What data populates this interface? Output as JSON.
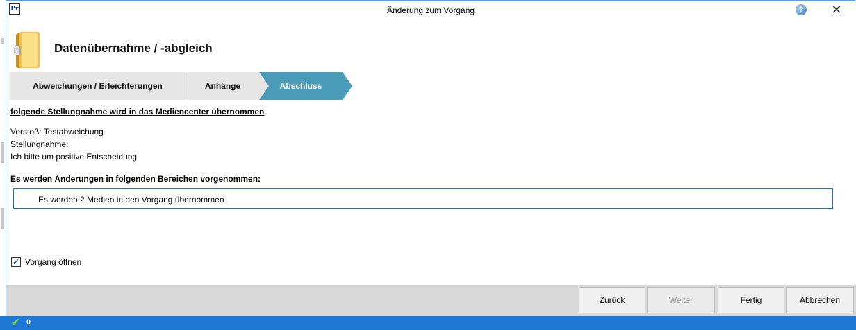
{
  "window": {
    "app_icon_text": "Pr",
    "title": "Änderung zum Vorgang",
    "help_icon": "question-mark-icon",
    "close_icon": "close-icon"
  },
  "header": {
    "icon": "folder-icon",
    "title": "Datenübernahme / -abgleich"
  },
  "wizard_steps": [
    {
      "label": "Abweichungen / Erleichterungen",
      "active": false
    },
    {
      "label": "Anhänge",
      "active": false
    },
    {
      "label": "Abschluss",
      "active": true
    }
  ],
  "content": {
    "section_title": "folgende Stellungnahme wird in das Mediencenter übernommen",
    "lines": [
      "Verstoß: Testabweichung",
      "Stellungnahme:",
      "Ich bitte um positive Entscheidung"
    ],
    "changes_title": "Es werden Änderungen in folgenden Bereichen vorgenommen:",
    "changes_items": [
      "Es werden 2 Medien in den Vorgang übernommen"
    ]
  },
  "options": {
    "open_case_label": "Vorgang öffnen",
    "open_case_checked": true
  },
  "footer": {
    "back_label": "Zurück",
    "next_label": "Weiter",
    "finish_label": "Fertig",
    "cancel_label": "Abbrechen"
  },
  "statusbar": {
    "icon": "checkmark-icon",
    "count": "0"
  },
  "colors": {
    "active_step": "#4a9bb7",
    "inactive_step": "#e6e6e6",
    "statusbar": "#1c78d4",
    "footer": "#d9d9d9",
    "changes_border": "#3a6e8a"
  }
}
